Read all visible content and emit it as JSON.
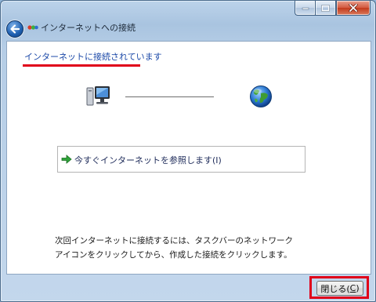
{
  "window": {
    "title": "インターネットへの接続"
  },
  "status": {
    "heading": "インターネットに接続されています"
  },
  "diagram": {
    "left_icon": "computer-icon",
    "right_icon": "globe-icon"
  },
  "task": {
    "icon": "green-arrow-icon",
    "label": "今すぐインターネットを参照します(I)"
  },
  "instruction": {
    "line1": "次回インターネットに接続するには、タスクバーのネットワーク",
    "line2": "アイコンをクリックしてから、作成した接続をクリックします。"
  },
  "footer": {
    "close_label": "閉じる(",
    "close_accel": "C",
    "close_suffix": ")"
  },
  "colors": {
    "highlight": "#e0001a",
    "heading_text": "#1c49a8"
  }
}
